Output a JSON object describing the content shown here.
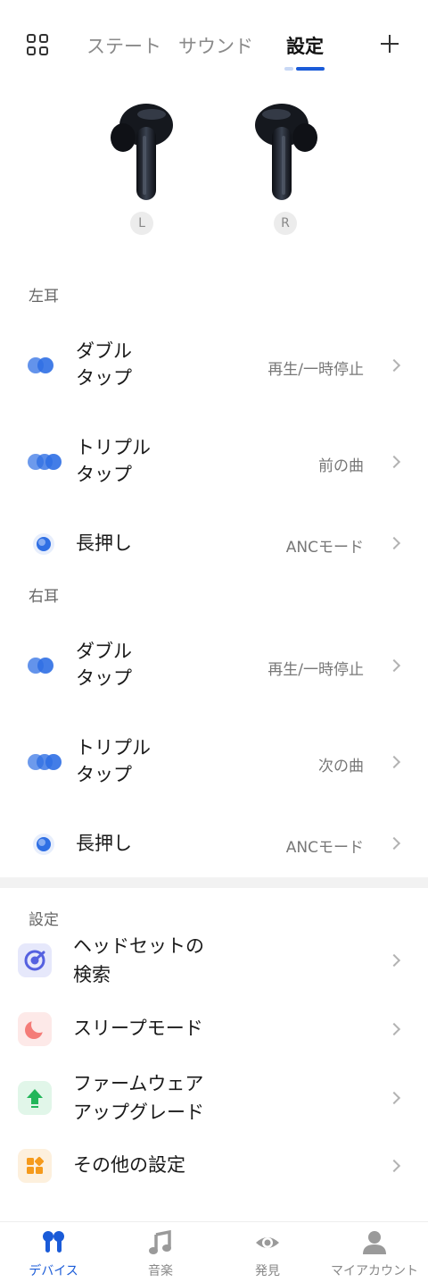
{
  "header": {
    "tabs": [
      {
        "label": "ステート"
      },
      {
        "label": "サウンド"
      },
      {
        "label": "設定"
      }
    ],
    "active_tab": "設定"
  },
  "earbuds": {
    "left_label": "L",
    "right_label": "R"
  },
  "left_ear": {
    "section_title": "左耳",
    "rows": [
      {
        "title": "ダブル\nタップ",
        "value": "再生/一時停止"
      },
      {
        "title": "トリプル\nタップ",
        "value": "前の曲"
      },
      {
        "title": "長押し",
        "value": "ANCモード"
      }
    ]
  },
  "right_ear": {
    "section_title": "右耳",
    "rows": [
      {
        "title": "ダブル\nタップ",
        "value": "再生/一時停止"
      },
      {
        "title": "トリプル\nタップ",
        "value": "次の曲"
      },
      {
        "title": "長押し",
        "value": "ANCモード"
      }
    ]
  },
  "settings": {
    "section_title": "設定",
    "items": [
      {
        "title": "ヘッドセットの\n検索",
        "icon": "find-headset-icon",
        "color": "#5561e0",
        "bg": "#e6e8fb"
      },
      {
        "title": "スリープモード",
        "icon": "moon-icon",
        "color": "#f47c78",
        "bg": "#fde9e8"
      },
      {
        "title": "ファームウェア\nアップグレード",
        "icon": "upgrade-arrow-icon",
        "color": "#22b65a",
        "bg": "#e1f6e9"
      },
      {
        "title": "その他の設定",
        "icon": "grid-tiles-icon",
        "color": "#f59a1b",
        "bg": "#fdf0dd"
      }
    ]
  },
  "bottom_nav": {
    "items": [
      {
        "label": "デバイス",
        "icon": "earbuds-icon"
      },
      {
        "label": "音楽",
        "icon": "music-note-icon"
      },
      {
        "label": "発見",
        "icon": "eye-icon"
      },
      {
        "label": "マイアカウント",
        "icon": "person-icon"
      }
    ],
    "active": "デバイス"
  },
  "colors": {
    "accent": "#1a5bd8",
    "gesture_icon": "#2f6fe4"
  }
}
